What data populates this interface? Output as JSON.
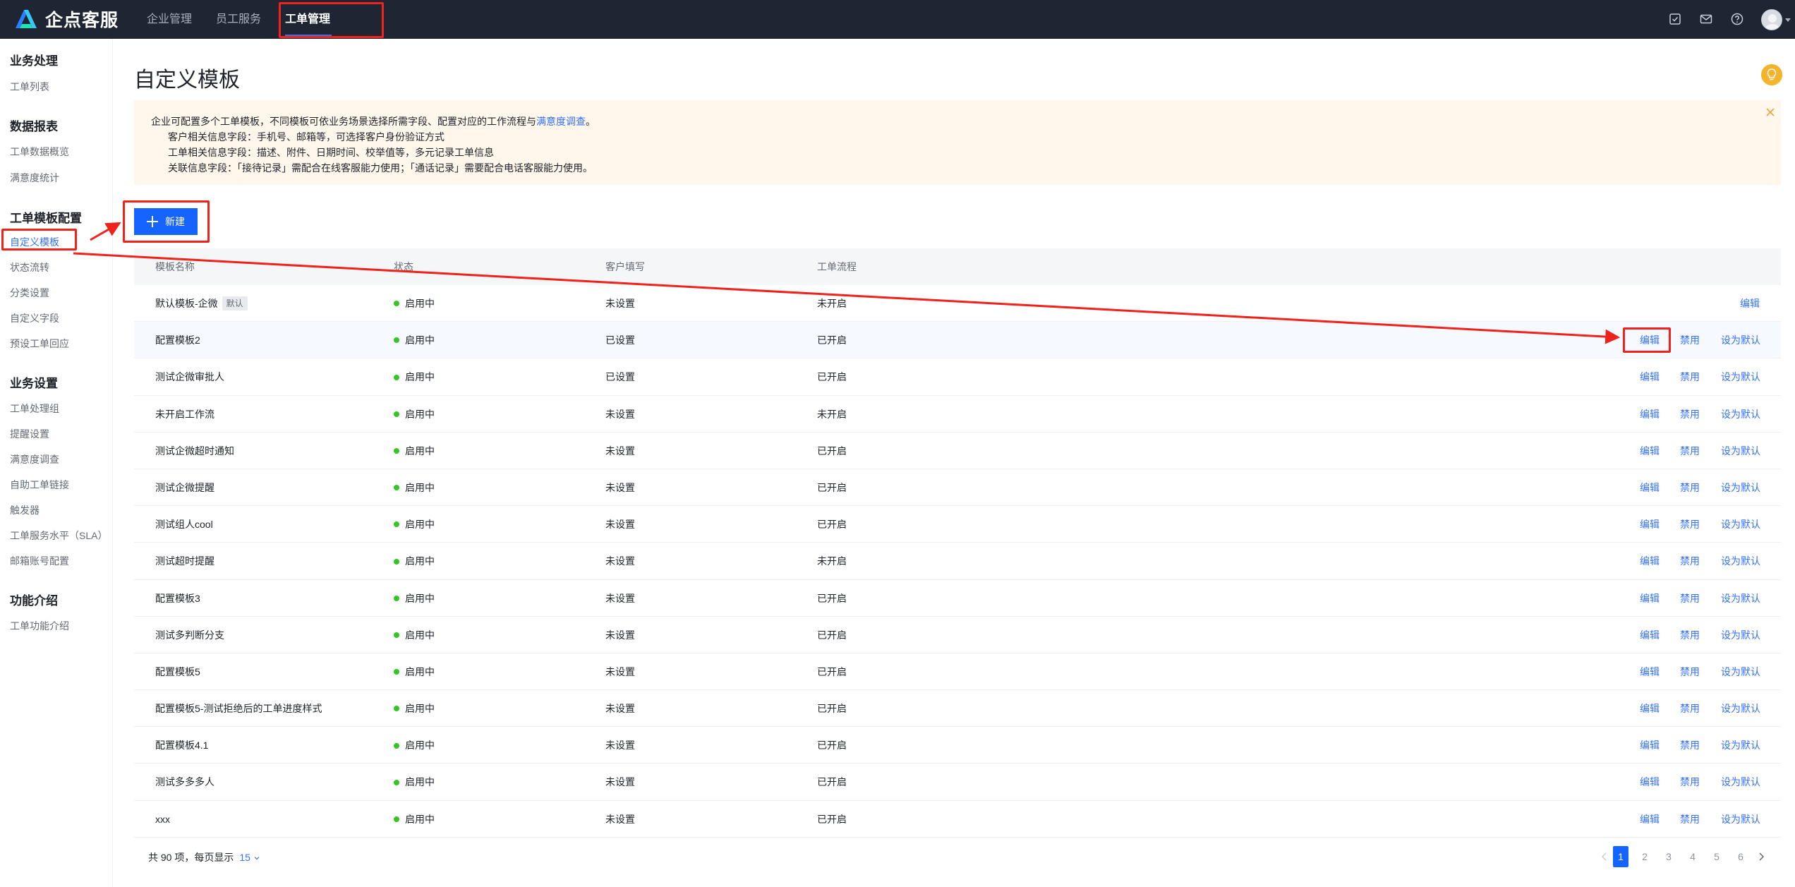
{
  "app": {
    "name": "企点客服"
  },
  "topnav": {
    "items": [
      {
        "label": "企业管理"
      },
      {
        "label": "员工服务"
      },
      {
        "label": "工单管理"
      }
    ]
  },
  "sidebar": {
    "groups": [
      {
        "title": "业务处理",
        "items": [
          "工单列表"
        ]
      },
      {
        "title": "数据报表",
        "items": [
          "工单数据概览",
          "满意度统计"
        ]
      },
      {
        "title": "工单模板配置",
        "items": [
          "自定义模板",
          "状态流转",
          "分类设置",
          "自定义字段",
          "预设工单回应"
        ]
      },
      {
        "title": "业务设置",
        "items": [
          "工单处理组",
          "提醒设置",
          "满意度调查",
          "自助工单链接",
          "触发器",
          "工单服务水平（SLA）",
          "邮箱账号配置"
        ]
      },
      {
        "title": "功能介绍",
        "items": [
          "工单功能介绍"
        ]
      }
    ],
    "active_item": "自定义模板"
  },
  "page": {
    "title": "自定义模板",
    "notice": {
      "line1_prefix": "企业可配置多个工单模板，不同模板可依业务场景选择所需字段、配置对应的工作流程与",
      "line1_link": "满意度调查",
      "line1_suffix": "。",
      "line2": "客户相关信息字段：手机号、邮箱等，可选择客户身份验证方式",
      "line3": "工单相关信息字段：描述、附件、日期时间、校举值等，多元记录工单信息",
      "line4": "关联信息字段：「接待记录」需配合在线客服能力使用；「通话记录」需要配合电话客服能力使用。"
    },
    "new_button": "新建"
  },
  "table": {
    "headers": [
      "模板名称",
      "状态",
      "客户填写",
      "工单流程"
    ],
    "default_badge": "默认",
    "rows": [
      {
        "name": "默认模板-企微",
        "is_default": true,
        "status": "启用中",
        "fill": "未设置",
        "flow": "未开启",
        "actions": [
          "编辑"
        ]
      },
      {
        "name": "配置模板2",
        "status": "启用中",
        "fill": "已设置",
        "flow": "已开启",
        "actions": [
          "编辑",
          "禁用",
          "设为默认"
        ]
      },
      {
        "name": "测试企微审批人",
        "status": "启用中",
        "fill": "已设置",
        "flow": "已开启",
        "actions": [
          "编辑",
          "禁用",
          "设为默认"
        ]
      },
      {
        "name": "未开启工作流",
        "status": "启用中",
        "fill": "未设置",
        "flow": "未开启",
        "actions": [
          "编辑",
          "禁用",
          "设为默认"
        ]
      },
      {
        "name": "测试企微超时通知",
        "status": "启用中",
        "fill": "未设置",
        "flow": "已开启",
        "actions": [
          "编辑",
          "禁用",
          "设为默认"
        ]
      },
      {
        "name": "测试企微提醒",
        "status": "启用中",
        "fill": "未设置",
        "flow": "已开启",
        "actions": [
          "编辑",
          "禁用",
          "设为默认"
        ]
      },
      {
        "name": "测试组人cool",
        "status": "启用中",
        "fill": "未设置",
        "flow": "已开启",
        "actions": [
          "编辑",
          "禁用",
          "设为默认"
        ]
      },
      {
        "name": "测试超时提醒",
        "status": "启用中",
        "fill": "未设置",
        "flow": "未开启",
        "actions": [
          "编辑",
          "禁用",
          "设为默认"
        ]
      },
      {
        "name": "配置模板3",
        "status": "启用中",
        "fill": "未设置",
        "flow": "已开启",
        "actions": [
          "编辑",
          "禁用",
          "设为默认"
        ]
      },
      {
        "name": "测试多判断分支",
        "status": "启用中",
        "fill": "未设置",
        "flow": "已开启",
        "actions": [
          "编辑",
          "禁用",
          "设为默认"
        ]
      },
      {
        "name": "配置模板5",
        "status": "启用中",
        "fill": "未设置",
        "flow": "已开启",
        "actions": [
          "编辑",
          "禁用",
          "设为默认"
        ]
      },
      {
        "name": "配置模板5-测试拒绝后的工单进度样式",
        "status": "启用中",
        "fill": "未设置",
        "flow": "已开启",
        "actions": [
          "编辑",
          "禁用",
          "设为默认"
        ]
      },
      {
        "name": "配置模板4.1",
        "status": "启用中",
        "fill": "未设置",
        "flow": "已开启",
        "actions": [
          "编辑",
          "禁用",
          "设为默认"
        ]
      },
      {
        "name": "测试多多多人",
        "status": "启用中",
        "fill": "未设置",
        "flow": "已开启",
        "actions": [
          "编辑",
          "禁用",
          "设为默认"
        ]
      },
      {
        "name": "xxx",
        "status": "启用中",
        "fill": "未设置",
        "flow": "已开启",
        "actions": [
          "编辑",
          "禁用",
          "设为默认"
        ]
      }
    ]
  },
  "pagination": {
    "total_text": "共 90 项，每页显示",
    "page_size": "15",
    "pages": [
      "1",
      "2",
      "3",
      "4",
      "5",
      "6"
    ],
    "current": "1"
  },
  "colors": {
    "topbar": "#1f2533",
    "accent": "#1664ff",
    "link": "#3370ff",
    "status_on": "#34c724",
    "notice_bg": "#fff6ec",
    "annotation": "#f0221c"
  }
}
